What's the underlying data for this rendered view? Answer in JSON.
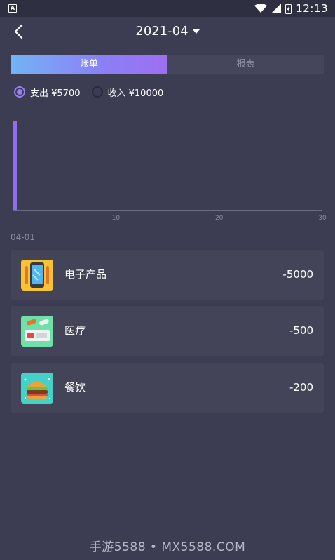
{
  "status_bar": {
    "time": "12:13",
    "left_icon": "A"
  },
  "header": {
    "month": "2021-04",
    "back_icon": "chevron-left-icon"
  },
  "tabs": [
    {
      "label": "账单",
      "active": true
    },
    {
      "label": "报表",
      "active": false
    }
  ],
  "filters": [
    {
      "label": "支出 ¥5700",
      "selected": true
    },
    {
      "label": "收入 ¥10000",
      "selected": false
    }
  ],
  "chart_data": {
    "type": "bar",
    "x": [
      1
    ],
    "values": [
      5700
    ],
    "x_ticks": [
      "10",
      "20",
      "30"
    ],
    "xlim": [
      0,
      30
    ],
    "ylim": [
      0,
      5700
    ],
    "color": "#8f6cf0",
    "grid": false
  },
  "date_label": "04-01",
  "records": [
    {
      "category": "电子产品",
      "amount": "-5000",
      "icon": "phone-icon",
      "icon_bg": "#f7c233"
    },
    {
      "category": "医疗",
      "amount": "-500",
      "icon": "medicine-icon",
      "icon_bg": "#6fe0a8"
    },
    {
      "category": "餐饮",
      "amount": "-200",
      "icon": "burger-icon",
      "icon_bg": "#44d1c8"
    }
  ],
  "watermark": "手游5588 • MX5588.COM"
}
